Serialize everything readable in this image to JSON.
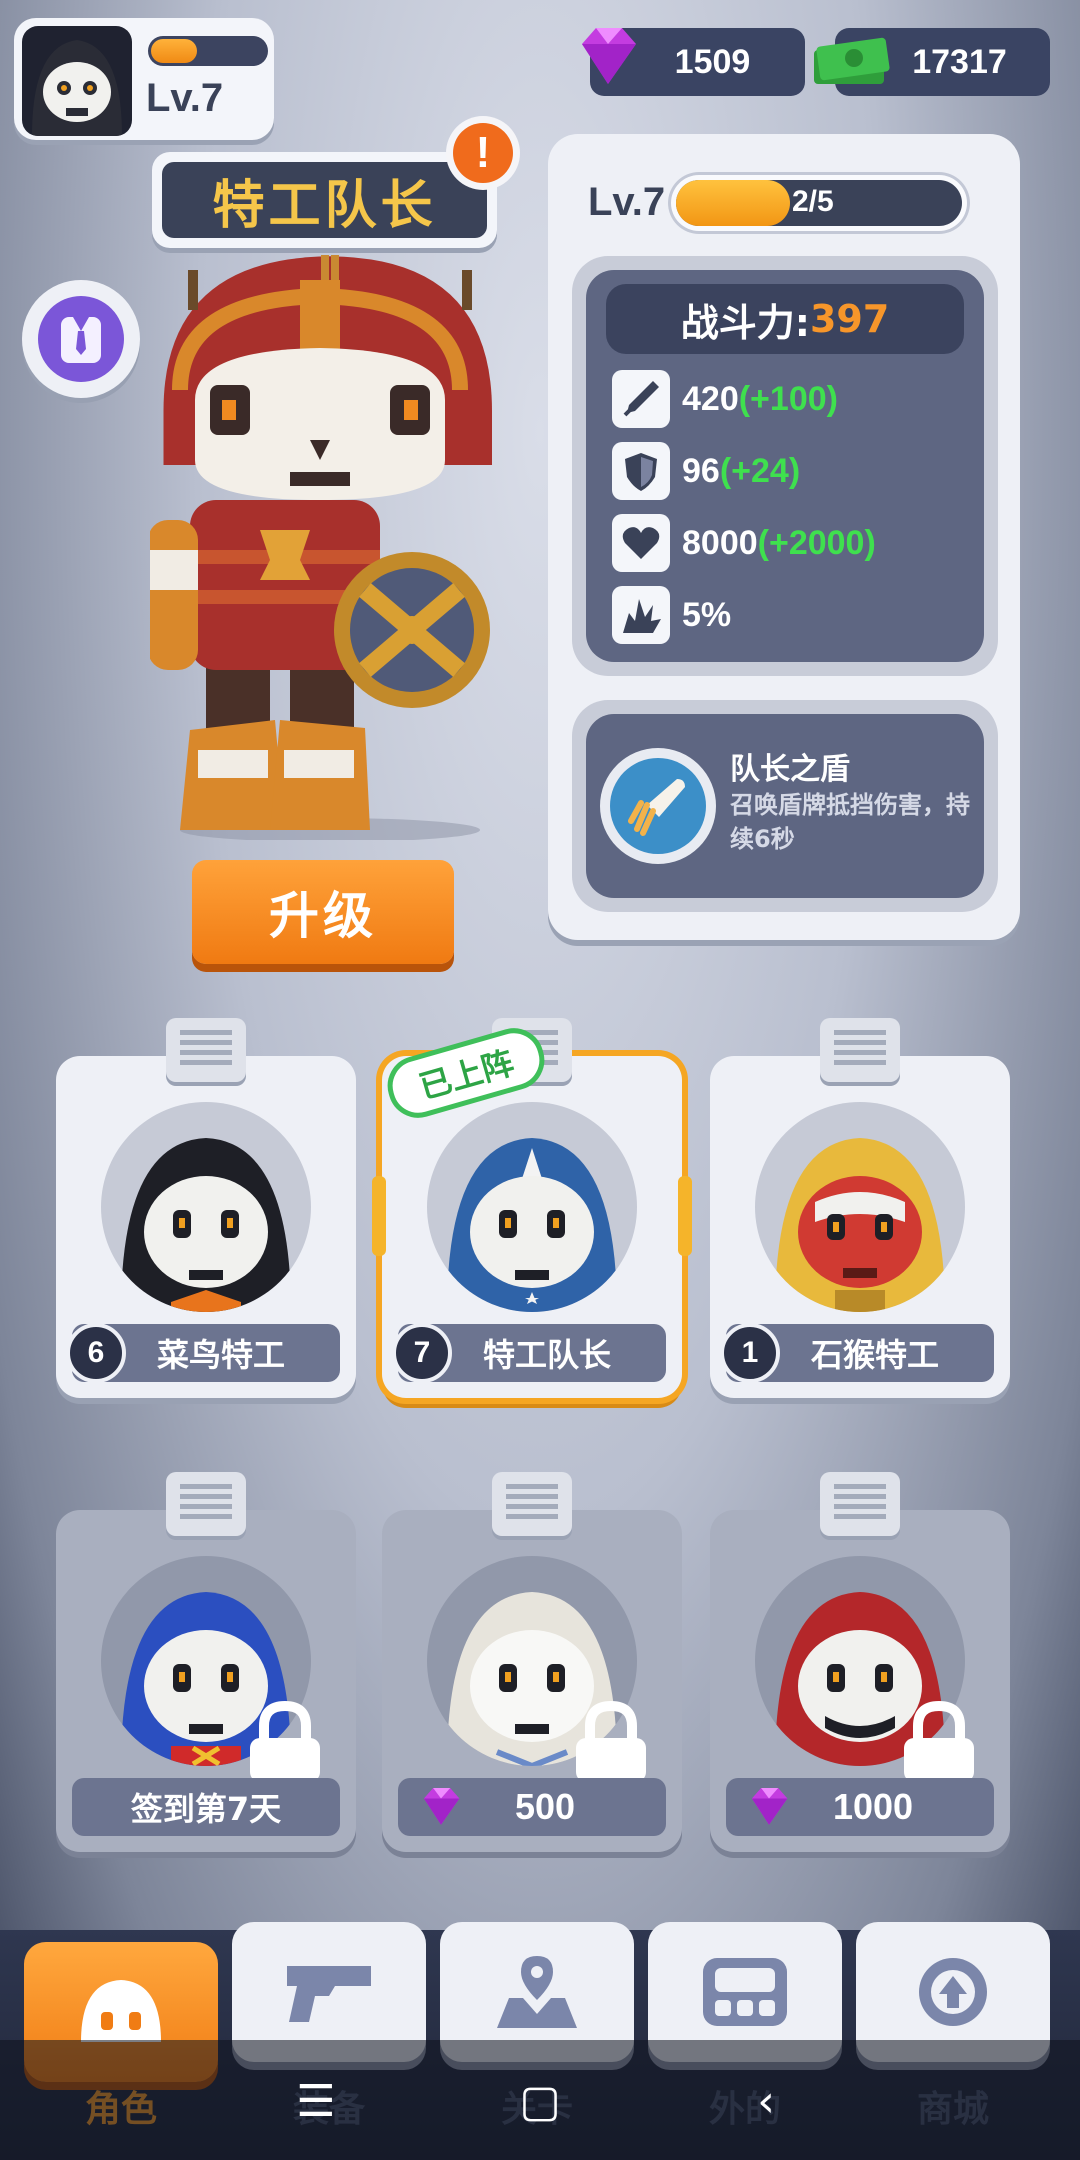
{
  "player": {
    "level": "Lv.7",
    "xp_fraction": 0.4
  },
  "currency": {
    "gems": "1509",
    "cash": "17317"
  },
  "hero": {
    "name": "特工队长",
    "alert": "!",
    "upgrade_label": "升级"
  },
  "stats": {
    "level": "Lv.7",
    "progress_text": "2/5",
    "progress_fraction": 0.4,
    "power_label": "战斗力:",
    "power_value": "397",
    "rows": [
      {
        "icon": "attack-icon",
        "value": "420",
        "bonus": "(+100)"
      },
      {
        "icon": "defense-icon",
        "value": "96",
        "bonus": "(+24)"
      },
      {
        "icon": "health-icon",
        "value": "8000",
        "bonus": "(+2000)"
      },
      {
        "icon": "crit-icon",
        "value": "5%",
        "bonus": ""
      }
    ]
  },
  "skill": {
    "name": "队长之盾",
    "description": "召唤盾牌抵挡伤害，持续6秒",
    "icon": "shield-rocket-icon"
  },
  "characters": [
    {
      "level": "6",
      "name": "菜鸟特工",
      "state": "owned",
      "hood": "#1e1f26"
    },
    {
      "level": "7",
      "name": "特工队长",
      "state": "selected",
      "hood": "#2f63a8",
      "tag": "已上阵"
    },
    {
      "level": "1",
      "name": "石猴特工",
      "state": "owned",
      "hood": "#e8b93c"
    },
    {
      "unlock": "签到第7天",
      "state": "locked",
      "hood": "#2b4fc0"
    },
    {
      "price": "500",
      "state": "locked",
      "hood": "#e7e4dc"
    },
    {
      "price": "1000",
      "state": "locked",
      "hood": "#b4272a"
    }
  ],
  "nav": [
    {
      "label": "角色",
      "active": true,
      "icon": "character-icon"
    },
    {
      "label": "装备",
      "active": false,
      "icon": "weapon-icon"
    },
    {
      "label": "关卡",
      "active": false,
      "icon": "map-icon"
    },
    {
      "label": "外的",
      "active": false,
      "icon": "outfit-icon"
    },
    {
      "label": "商城",
      "active": false,
      "icon": "shop-icon"
    }
  ],
  "system_nav": {
    "menu": "☰",
    "home": "▢",
    "back": "‹"
  },
  "colors": {
    "accent": "#f5962a",
    "bonus": "#3fe04e",
    "panel_dark": "#3a4258"
  }
}
